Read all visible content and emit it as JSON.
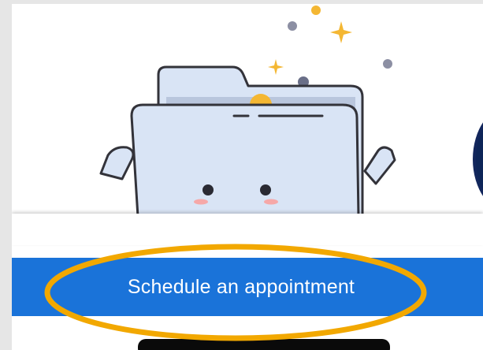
{
  "schedule_button": {
    "label": "Schedule an appointment"
  },
  "annotation": {
    "shape": "ellipse-outline",
    "color": "#f2a800"
  },
  "colors": {
    "primary_blue": "#1a73d9",
    "folder_fill": "#d9e4f5",
    "folder_outline": "#33333a",
    "sparkle": "#f4b733",
    "dot_grey": "#8c8fa3",
    "dark_navy": "#0d2558"
  },
  "icons": {
    "illustration": "folder-mascot-icon",
    "sparkle": "sparkle-icon"
  }
}
